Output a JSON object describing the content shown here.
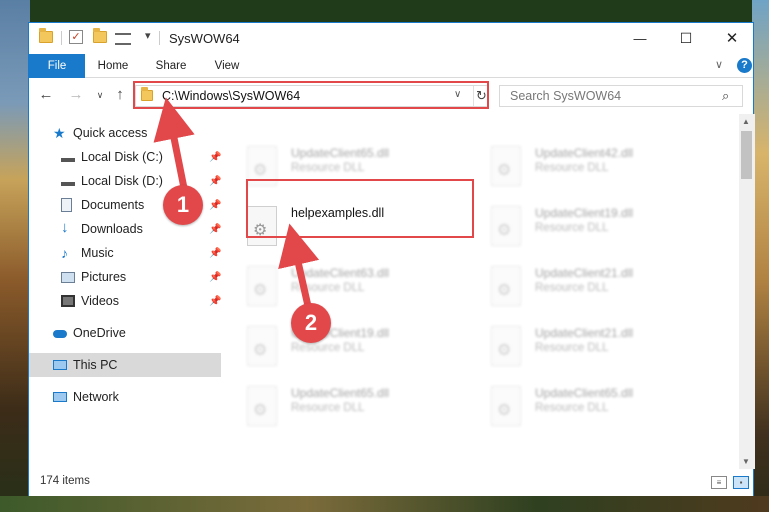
{
  "window": {
    "title": "SysWOW64",
    "minimize_icon": "—",
    "maximize_icon": "☐",
    "close_icon": "✕"
  },
  "ribbon": {
    "tabs": [
      {
        "label": "File"
      },
      {
        "label": "Home"
      },
      {
        "label": "Share"
      },
      {
        "label": "View"
      }
    ],
    "help_label": "?",
    "collapse_icon": "∨"
  },
  "nav": {
    "back_icon": "←",
    "forward_icon": "→",
    "recent_icon": "∨",
    "up_icon": "↑"
  },
  "address": {
    "path": "C:\\Windows\\SysWOW64",
    "dropdown_icon": "∨",
    "refresh_icon": "↻"
  },
  "search": {
    "placeholder": "Search SysWOW64",
    "icon": "⌕"
  },
  "sidebar": {
    "items": [
      {
        "label": "Quick access",
        "icon": "star-icon",
        "pinned": false
      },
      {
        "label": "Local Disk (C:)",
        "icon": "drive-icon",
        "pinned": true
      },
      {
        "label": "Local Disk (D:)",
        "icon": "drive-icon",
        "pinned": true
      },
      {
        "label": "Documents",
        "icon": "documents-icon",
        "pinned": true
      },
      {
        "label": "Downloads",
        "icon": "download-icon",
        "pinned": true
      },
      {
        "label": "Music",
        "icon": "music-icon",
        "pinned": true
      },
      {
        "label": "Pictures",
        "icon": "pictures-icon",
        "pinned": true
      },
      {
        "label": "Videos",
        "icon": "videos-icon",
        "pinned": true
      },
      {
        "label": "OneDrive",
        "icon": "cloud-icon",
        "pinned": false
      },
      {
        "label": "This PC",
        "icon": "computer-icon",
        "pinned": false,
        "selected": true
      },
      {
        "label": "Network",
        "icon": "network-icon",
        "pinned": false
      }
    ],
    "pin_glyph": "📌"
  },
  "files": {
    "left_column": [
      {
        "name": "UpdateClient65.dll",
        "type": "Resource DLL",
        "blurred": true
      },
      {
        "name": "helpexamples.dll",
        "type": "",
        "blurred": false
      },
      {
        "name": "UpdateClient63.dll",
        "type": "Resource DLL",
        "blurred": true
      },
      {
        "name": "UpdateClient19.dll",
        "type": "Resource DLL",
        "blurred": true
      },
      {
        "name": "UpdateClient65.dll",
        "type": "Resource DLL",
        "blurred": true
      }
    ],
    "right_column": [
      {
        "name": "UpdateClient42.dll",
        "type": "Resource DLL",
        "blurred": true
      },
      {
        "name": "UpdateClient19.dll",
        "type": "Resource DLL",
        "blurred": true
      },
      {
        "name": "UpdateClient21.dll",
        "type": "Resource DLL",
        "blurred": true
      },
      {
        "name": "UpdateClient21.dll",
        "type": "Resource DLL",
        "blurred": true
      },
      {
        "name": "UpdateClient65.dll",
        "type": "Resource DLL",
        "blurred": true
      }
    ]
  },
  "status": {
    "item_count": "174 items"
  },
  "callouts": [
    {
      "label": "1"
    },
    {
      "label": "2"
    }
  ],
  "colors": {
    "accent": "#1979ca",
    "highlight": "#e2474a",
    "selected_bg": "#d9d9d9"
  }
}
